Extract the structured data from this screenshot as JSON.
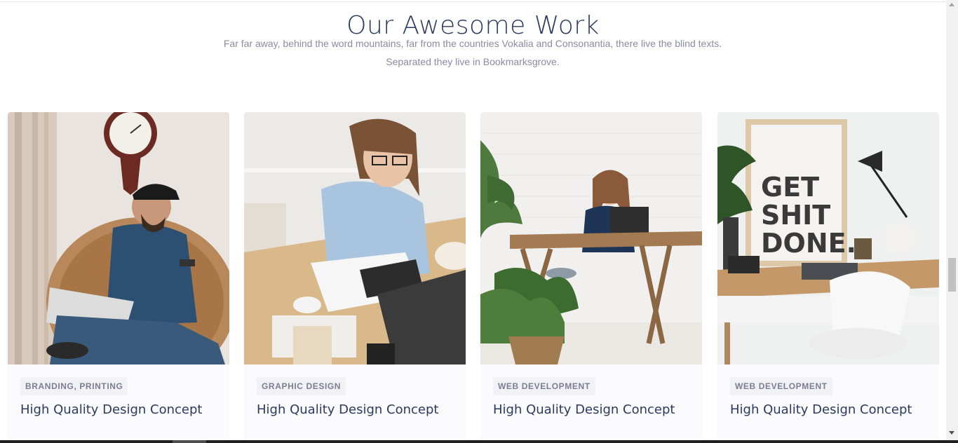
{
  "section": {
    "title": "Our Awesome Work",
    "subtitle_line1": "Far far away, behind the word mountains, far from the countries Vokalia and Consonantia, there live the blind texts.",
    "subtitle_line2": "Separated they live in Bookmarksgrove."
  },
  "cards": [
    {
      "tag": "BRANDING, PRINTING",
      "title": "High Quality Design Concept",
      "image": "man-in-rattan-chair-with-laptop"
    },
    {
      "tag": "GRAPHIC DESIGN",
      "title": "High Quality Design Concept",
      "image": "woman-writing-at-desk"
    },
    {
      "tag": "WEB DEVELOPMENT",
      "title": "High Quality Design Concept",
      "image": "woman-at-wooden-table-with-laptop"
    },
    {
      "tag": "WEB DEVELOPMENT",
      "title": "High Quality Design Concept",
      "image": "desk-with-poster",
      "poster_text": [
        "GET",
        "SHIT",
        "DONE."
      ]
    }
  ]
}
